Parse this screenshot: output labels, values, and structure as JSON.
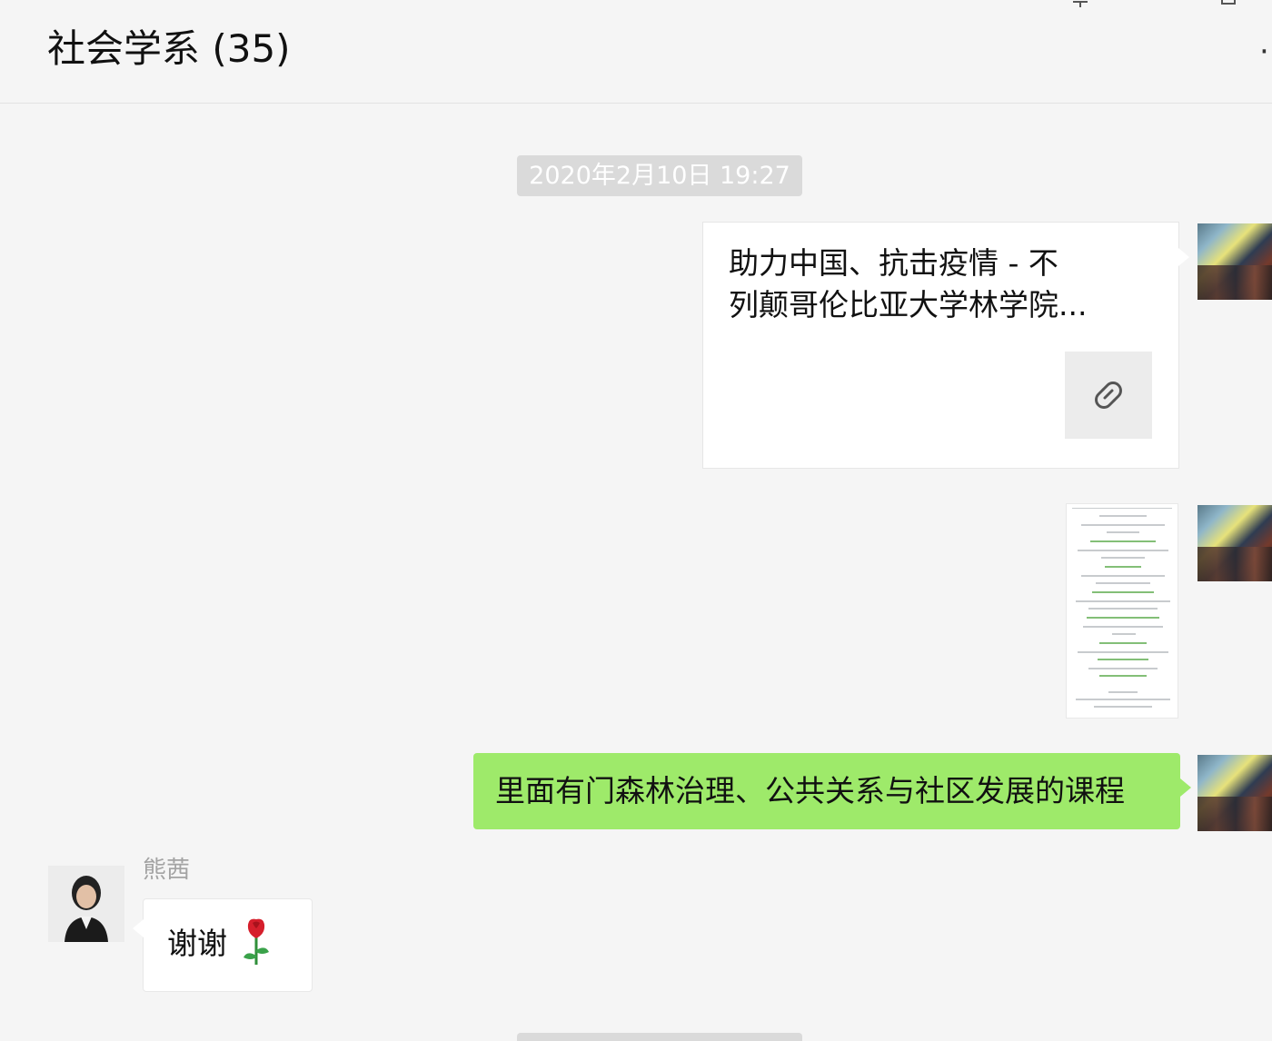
{
  "header": {
    "title": "社会学系 (35)",
    "more_icon": "more-dots-icon"
  },
  "messages": {
    "timestamp": "2020年2月10日 19:27",
    "link_card": {
      "title": "助力中国、抗击疫情 - 不\n列颠哥伦比亚大学林学院...",
      "icon": "link-icon"
    },
    "image_message": {
      "icon": "image-thumbnail"
    },
    "my_text": "里面有门森林治理、公共关系与社区发展的课程",
    "other_sender_name": "熊茜",
    "other_text": "谢谢",
    "other_emoji_icon": "rose-icon"
  },
  "colors": {
    "background": "#f5f5f5",
    "my_bubble": "#9eea6a",
    "other_bubble": "#ffffff",
    "timestamp_bg": "#dadada",
    "sender_name": "#a3a3a3"
  }
}
